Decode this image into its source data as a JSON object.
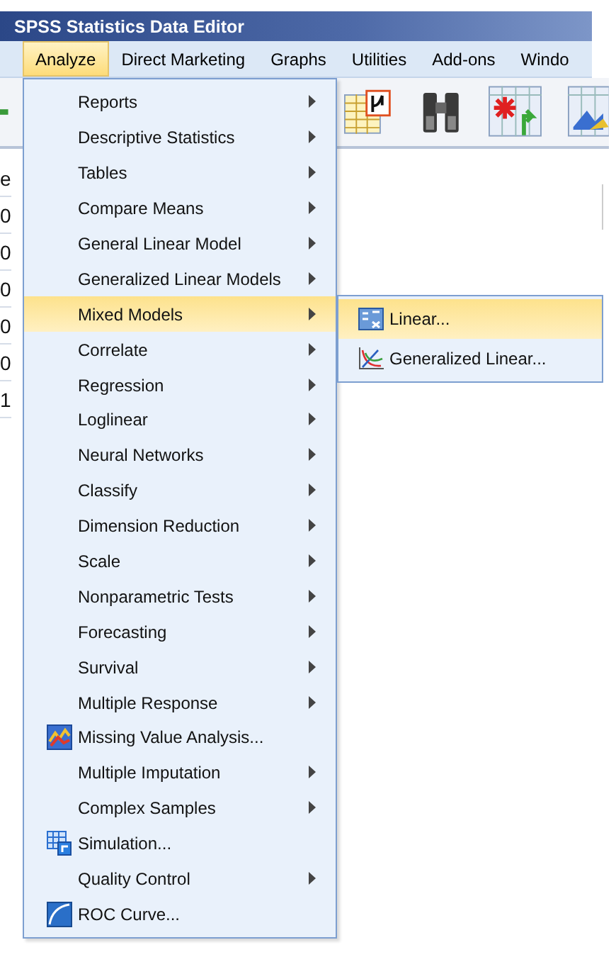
{
  "window": {
    "title": "SPSS Statistics Data Editor"
  },
  "menu_bar": [
    {
      "label": "Analyze",
      "selected": true
    },
    {
      "label": "Direct Marketing",
      "selected": false
    },
    {
      "label": "Graphs",
      "selected": false
    },
    {
      "label": "Utilities",
      "selected": false
    },
    {
      "label": "Add-ons",
      "selected": false
    },
    {
      "label": "Windo",
      "selected": false
    }
  ],
  "data_column": [
    "e",
    "0",
    "0",
    "0",
    "0",
    "0",
    "1"
  ],
  "analyze_menu": [
    {
      "label": "Reports",
      "kind": "submenu",
      "selected": false
    },
    {
      "label": "Descriptive Statistics",
      "kind": "submenu",
      "selected": false
    },
    {
      "label": "Tables",
      "kind": "submenu",
      "selected": false
    },
    {
      "label": "Compare Means",
      "kind": "submenu",
      "selected": false
    },
    {
      "label": "General Linear Model",
      "kind": "submenu",
      "selected": false
    },
    {
      "label": "Generalized Linear Models",
      "kind": "submenu",
      "selected": false
    },
    {
      "label": "Mixed Models",
      "kind": "submenu",
      "selected": true
    },
    {
      "label": "Correlate",
      "kind": "submenu",
      "selected": false
    },
    {
      "label": "Regression",
      "kind": "submenu",
      "selected": false
    },
    {
      "label": "Loglinear",
      "kind": "submenu",
      "selected": false
    },
    {
      "label": "Neural Networks",
      "kind": "submenu",
      "selected": false
    },
    {
      "label": "Classify",
      "kind": "submenu",
      "selected": false
    },
    {
      "label": "Dimension Reduction",
      "kind": "submenu",
      "selected": false
    },
    {
      "label": "Scale",
      "kind": "submenu",
      "selected": false
    },
    {
      "label": "Nonparametric Tests",
      "kind": "submenu",
      "selected": false
    },
    {
      "label": "Forecasting",
      "kind": "submenu",
      "selected": false
    },
    {
      "label": "Survival",
      "kind": "submenu",
      "selected": false
    },
    {
      "label": "Multiple Response",
      "kind": "submenu",
      "selected": false
    },
    {
      "label": "Missing Value Analysis...",
      "kind": "action",
      "selected": false
    },
    {
      "label": "Multiple Imputation",
      "kind": "submenu",
      "selected": false
    },
    {
      "label": "Complex Samples",
      "kind": "submenu",
      "selected": false
    },
    {
      "label": "Simulation...",
      "kind": "action",
      "selected": false
    },
    {
      "label": "Quality Control",
      "kind": "submenu",
      "selected": false
    },
    {
      "label": "ROC Curve...",
      "kind": "action",
      "selected": false
    }
  ],
  "mixed_models_submenu": [
    {
      "label": "Linear...",
      "selected": true
    },
    {
      "label": "Generalized Linear...",
      "selected": false
    }
  ]
}
